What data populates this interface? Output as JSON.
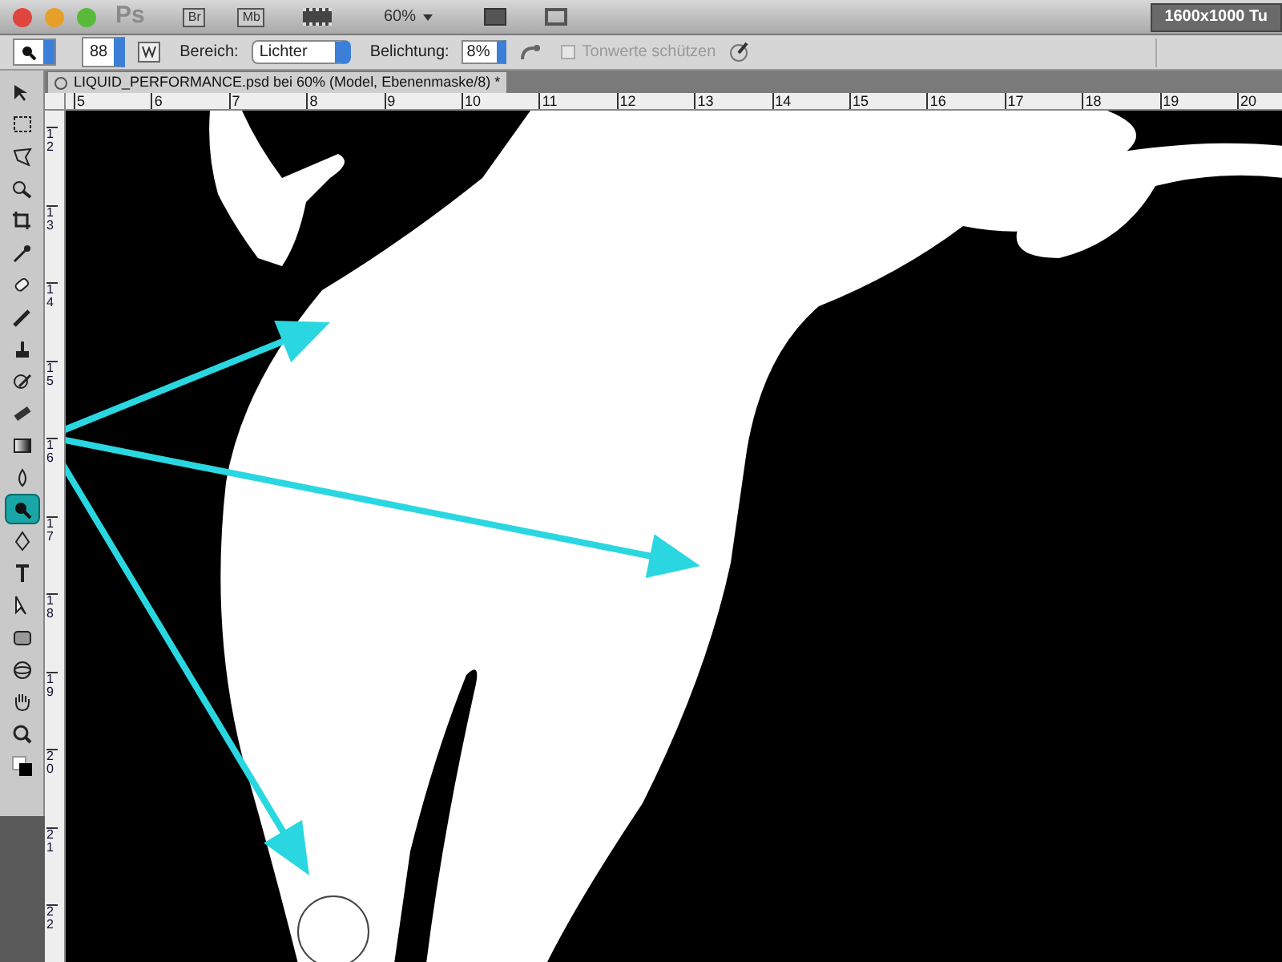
{
  "app_bar": {
    "logo": "Ps",
    "bridge": "Br",
    "mini_bridge": "Mb",
    "zoom": "60%",
    "workspace": "1600x1000 Tu"
  },
  "options_bar": {
    "brush_size": "88",
    "range_label": "Bereich:",
    "range_value": "Lichter",
    "exposure_label": "Belichtung:",
    "exposure_value": "8%",
    "protect_tones": {
      "label": "Tonwerte schützen",
      "checked": false,
      "disabled": true
    }
  },
  "document_tab": {
    "title": "LIQUID_PERFORMANCE.psd bei 60% (Model, Ebenenmaske/8) *"
  },
  "ruler_h": [
    "5",
    "6",
    "7",
    "8",
    "9",
    "10",
    "11",
    "12",
    "13",
    "14",
    "15",
    "16",
    "17",
    "18",
    "19",
    "20"
  ],
  "ruler_v": [
    "12",
    "13",
    "14",
    "15",
    "16",
    "17",
    "18",
    "19",
    "20",
    "21",
    "22"
  ],
  "tools": [
    {
      "selected": false
    },
    {
      "selected": false
    },
    {
      "selected": false
    },
    {
      "selected": false
    },
    {
      "selected": false
    },
    {
      "selected": false
    },
    {
      "selected": false
    },
    {
      "selected": false
    },
    {
      "selected": false
    },
    {
      "selected": false
    },
    {
      "selected": false
    },
    {
      "selected": false
    },
    {
      "selected": false
    },
    {
      "selected": true
    },
    {
      "selected": false
    },
    {
      "selected": false
    },
    {
      "selected": false
    },
    {
      "selected": false
    },
    {
      "selected": false
    },
    {
      "selected": false
    },
    {
      "selected": false
    },
    {
      "selected": false
    }
  ]
}
